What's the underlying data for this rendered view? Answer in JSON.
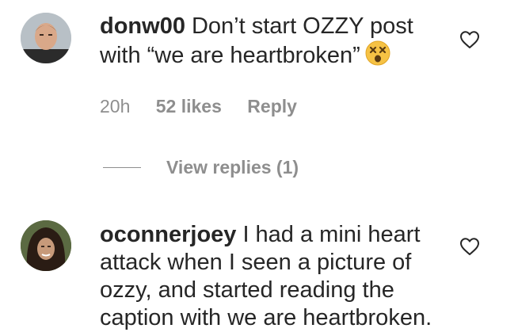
{
  "comments": [
    {
      "username": "donw00",
      "text": "Don’t start OZZY post with “we are heartbroken”",
      "emoji": "dizzy-face-emoji",
      "time": "20h",
      "likes": "52 likes",
      "reply_label": "Reply",
      "view_replies": "View replies (1)"
    },
    {
      "username": "oconnerjoey",
      "text": "I had a mini heart attack when I seen a picture of ozzy, and started reading the caption with we are heartbroken."
    }
  ],
  "colors": {
    "text": "#262626",
    "secondary": "#8e8e8e",
    "emoji_face": "#f6c244"
  }
}
